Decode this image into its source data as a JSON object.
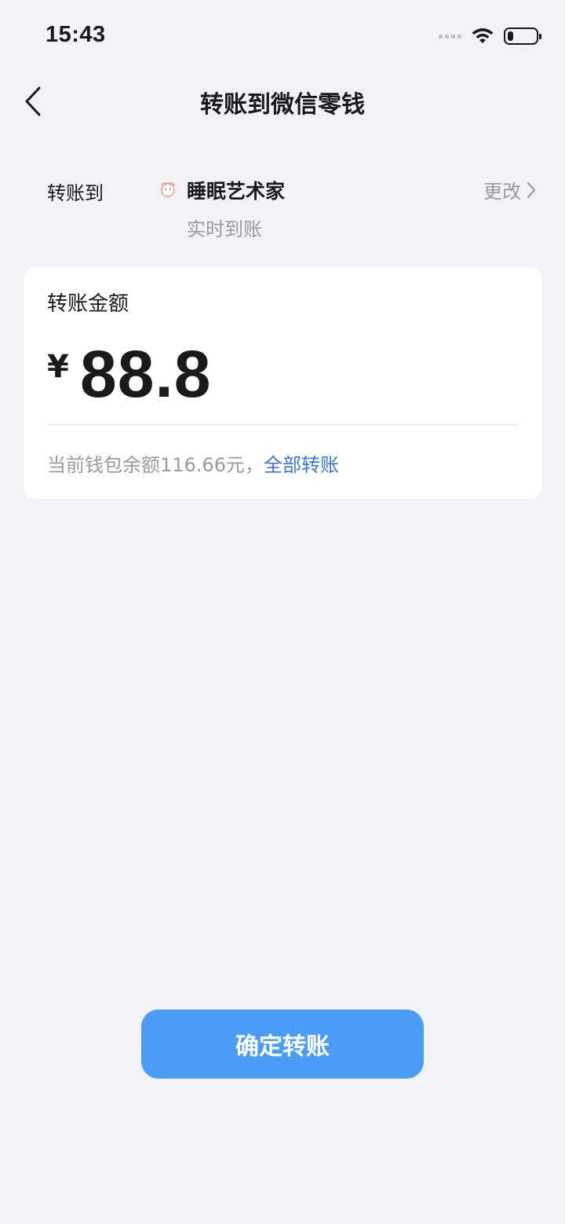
{
  "status_bar": {
    "time": "15:43",
    "icons": [
      "signal-icon",
      "wifi-icon",
      "battery-icon"
    ],
    "battery_level": 0.2
  },
  "nav": {
    "back_icon": "chevron-left-icon",
    "title": "转账到微信零钱"
  },
  "recipient": {
    "label": "转账到",
    "avatar_icon": "avatar",
    "name": "睡眠艺术家",
    "subtitle": "实时到账",
    "change_label": "更改",
    "change_icon": "chevron-right-icon"
  },
  "amount_card": {
    "label": "转账金额",
    "currency_symbol": "¥",
    "amount": "88.8",
    "balance_text": "当前钱包余额116.66元，",
    "transfer_all_label": "全部转账"
  },
  "confirm_button": {
    "label": "确定转账"
  },
  "colors": {
    "background": "#f2f2f7",
    "card": "#ffffff",
    "primary_button": "#4a9cf6",
    "link": "#3877d6",
    "secondary_text": "#9a9aa0"
  }
}
